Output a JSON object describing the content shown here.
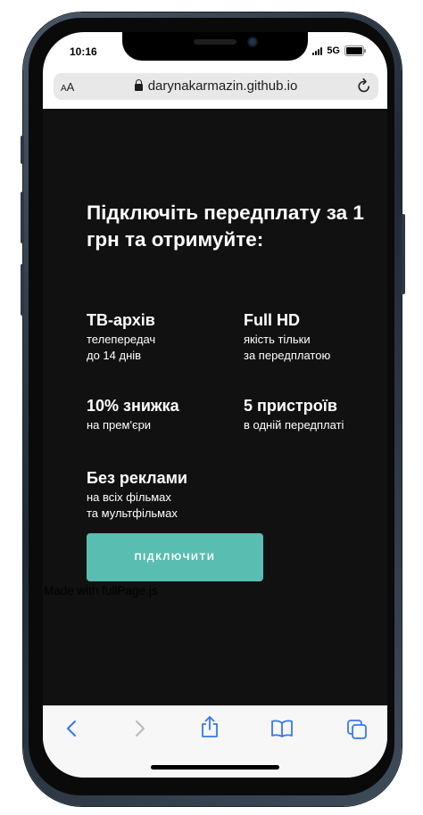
{
  "status_bar": {
    "time": "10:16",
    "network": "5G"
  },
  "browser": {
    "text_size_label": "AA",
    "url": "darynakarmazin.github.io",
    "icons": [
      "lock-icon",
      "reload-icon"
    ]
  },
  "page": {
    "headline": "Підключіть передплату за 1 грн та отримуйте:",
    "features": [
      {
        "title": "ТВ-архів",
        "desc_lines": [
          "телепередач",
          "до 14 днів"
        ]
      },
      {
        "title": "Full HD",
        "desc_lines": [
          "якість тільки",
          "за передплатою"
        ]
      },
      {
        "title": "10% знижка",
        "desc_lines": [
          "на прем'єри"
        ]
      },
      {
        "title": "5 пристроїв",
        "desc_lines": [
          "в одній передплаті"
        ]
      },
      {
        "title": "Без реклами",
        "desc_lines": [
          "на всіх фільмах",
          "та мультфільмах"
        ]
      }
    ],
    "cta_label": "ПІДКЛЮЧИТИ",
    "credit": "Made with fullPage.js",
    "background_color": "#111112",
    "accent_color": "#59bdb1"
  },
  "toolbar": {
    "icons": [
      "back-icon",
      "forward-icon",
      "share-icon",
      "bookmarks-icon",
      "tabs-icon"
    ],
    "accent_color": "#3478f6"
  }
}
